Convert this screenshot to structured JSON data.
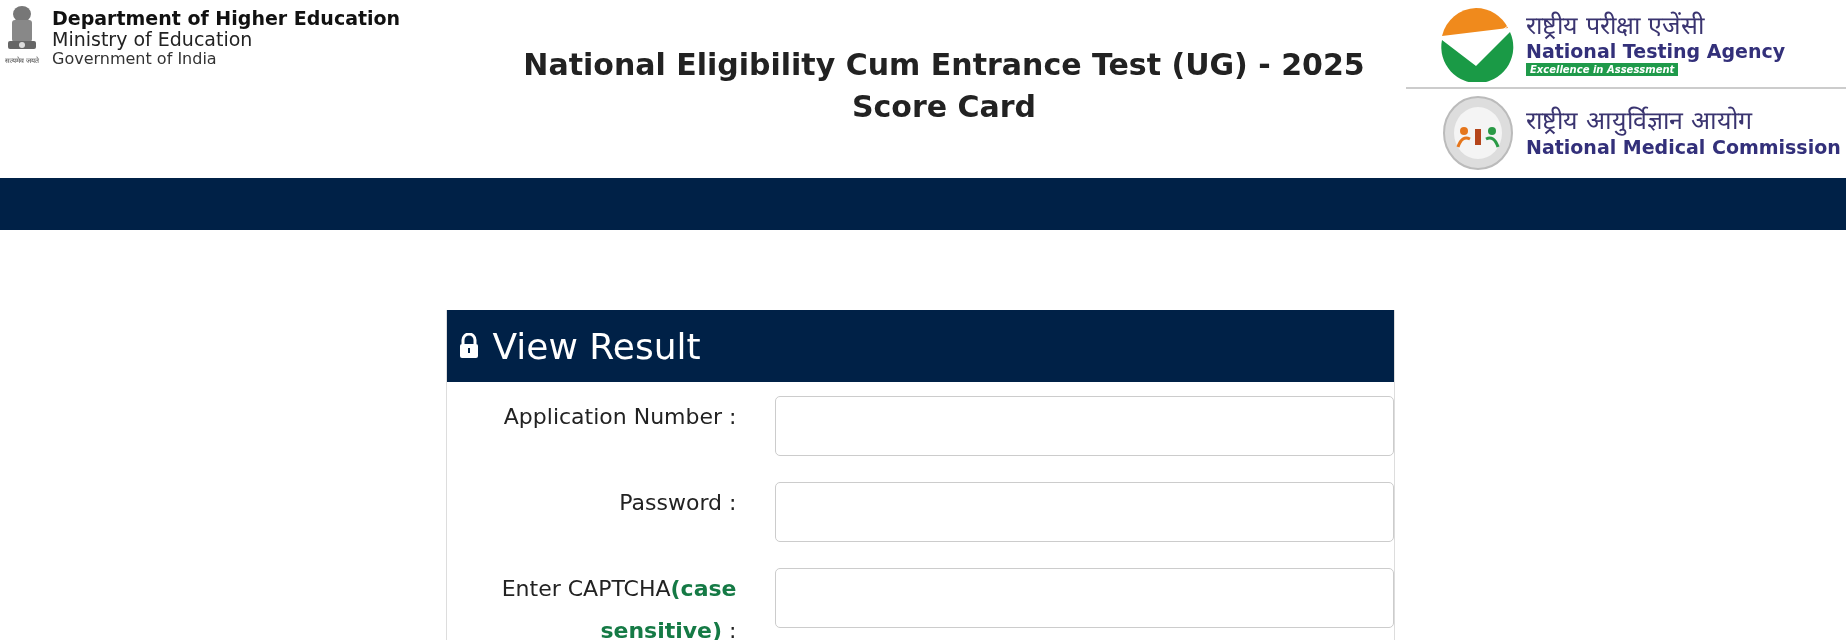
{
  "header": {
    "emblem_motto": "सत्यमेव जयते",
    "department": "Department of Higher Education",
    "ministry": "Ministry of Education",
    "government": "Government of India",
    "title_lines": [
      "National Eligibility Cum Entrance Test (UG) - 2025",
      "Score Card"
    ],
    "nta": {
      "hindi": "राष्ट्रीय परीक्षा एजेंसी",
      "english": "National Testing Agency",
      "tagline": "Excellence in Assessment"
    },
    "nmc": {
      "hindi": "राष्ट्रीय आयुर्विज्ञान आयोग",
      "english": "National Medical Commission"
    }
  },
  "form": {
    "title": "View Result",
    "fields": [
      {
        "label": "Application Number :"
      },
      {
        "label": "Password :"
      },
      {
        "label": "Enter CAPTCHA**(case sensitive)** :"
      }
    ]
  }
}
